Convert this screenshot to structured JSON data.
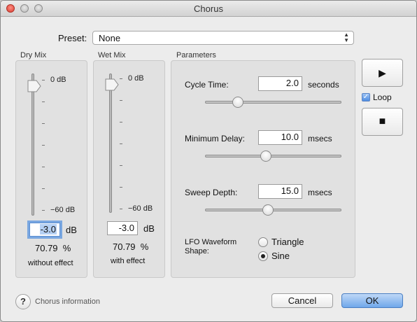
{
  "window": {
    "title": "Chorus"
  },
  "preset": {
    "label": "Preset:",
    "value": "None"
  },
  "dry_mix": {
    "group_label": "Dry Mix",
    "top_tick": "0 dB",
    "bottom_tick": "−60 dB",
    "value": "-3.0",
    "unit": "dB",
    "percent": "70.79  %",
    "caption": "without effect"
  },
  "wet_mix": {
    "group_label": "Wet Mix",
    "top_tick": "0 dB",
    "bottom_tick": "−60 dB",
    "value": "-3.0",
    "unit": "dB",
    "percent": "70.79  %",
    "caption": "with effect"
  },
  "parameters": {
    "group_label": "Parameters",
    "cycle_time": {
      "label": "Cycle Time:",
      "value": "2.0",
      "unit": "seconds",
      "slider_fraction": 0.22
    },
    "minimum_delay": {
      "label": "Minimum Delay:",
      "value": "10.0",
      "unit": "msecs",
      "slider_fraction": 0.44
    },
    "sweep_depth": {
      "label": "Sweep Depth:",
      "value": "15.0",
      "unit": "msecs",
      "slider_fraction": 0.46
    },
    "lfo": {
      "label": "LFO Waveform Shape:",
      "options": [
        "Triangle",
        "Sine"
      ],
      "selected": "Sine"
    }
  },
  "transport": {
    "play_glyph": "▶",
    "stop_glyph": "■",
    "loop_label": "Loop",
    "loop_checked": true
  },
  "footer": {
    "help_glyph": "?",
    "info_label": "Chorus information",
    "cancel_label": "Cancel",
    "ok_label": "OK"
  }
}
